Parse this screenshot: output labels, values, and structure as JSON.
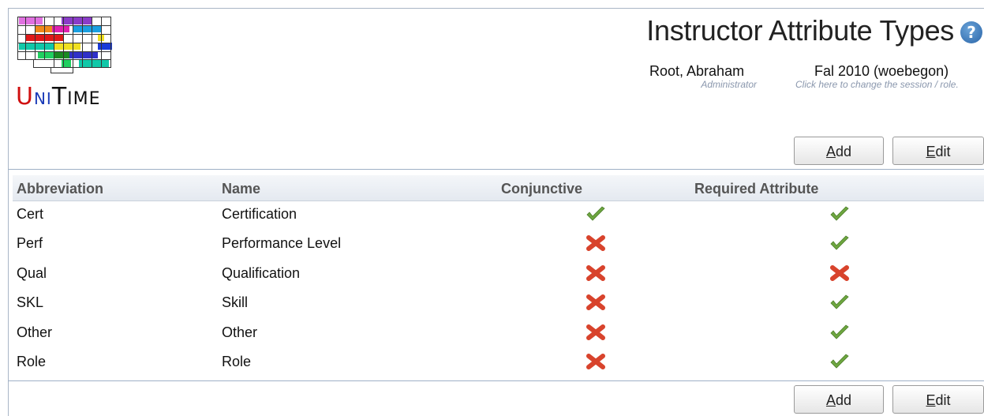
{
  "header": {
    "title": "Instructor Attribute Types",
    "help_icon": "question-icon"
  },
  "logo": {
    "word": [
      "U",
      "NI",
      "T",
      "I",
      "ME"
    ]
  },
  "user": {
    "name": "Root, Abraham",
    "role": "Administrator"
  },
  "session": {
    "name": "Fal 2010 (woebegon)",
    "hint": "Click here to change the session / role."
  },
  "buttons": {
    "add": {
      "underline": "A",
      "rest": "dd"
    },
    "edit": {
      "underline": "E",
      "rest": "dit"
    }
  },
  "table": {
    "columns": [
      "Abbreviation",
      "Name",
      "Conjunctive",
      "Required Attribute"
    ],
    "rows": [
      {
        "abbreviation": "Cert",
        "name": "Certification",
        "conjunctive": true,
        "required": true
      },
      {
        "abbreviation": "Perf",
        "name": "Performance Level",
        "conjunctive": false,
        "required": true
      },
      {
        "abbreviation": "Qual",
        "name": "Qualification",
        "conjunctive": false,
        "required": false
      },
      {
        "abbreviation": "SKL",
        "name": "Skill",
        "conjunctive": false,
        "required": true
      },
      {
        "abbreviation": "Other",
        "name": "Other",
        "conjunctive": false,
        "required": true
      },
      {
        "abbreviation": "Role",
        "name": "Role",
        "conjunctive": false,
        "required": true
      }
    ]
  },
  "colors": {
    "check": "#6ea640",
    "cross": "#d8432c",
    "accent": "#2a65a8"
  }
}
